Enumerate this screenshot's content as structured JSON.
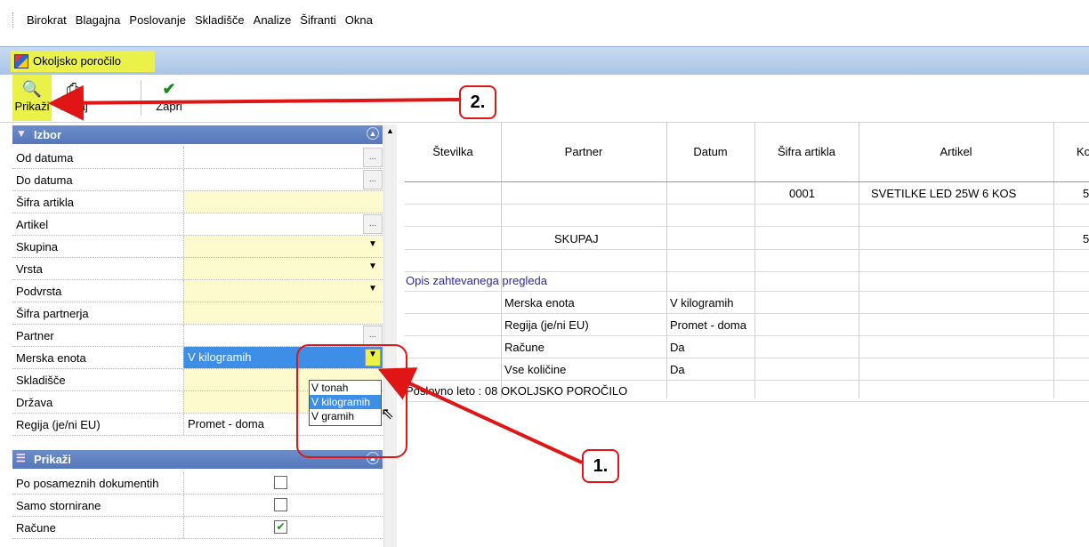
{
  "menu": [
    "Birokrat",
    "Blagajna",
    "Poslovanje",
    "Skladišče",
    "Analize",
    "Šifranti",
    "Okna"
  ],
  "window": {
    "title": "Okoljsko poročilo"
  },
  "toolbar": {
    "prikazi": "Prikaži",
    "tiskaj": "Tiskaj",
    "zapri": "Zapri"
  },
  "izbor": {
    "title": "Izbor",
    "rows": [
      {
        "label": "Od datuma",
        "value": ""
      },
      {
        "label": "Do datuma",
        "value": ""
      },
      {
        "label": "Šifra artikla",
        "value": ""
      },
      {
        "label": "Artikel",
        "value": ""
      },
      {
        "label": "Skupina",
        "value": ""
      },
      {
        "label": "Vrsta",
        "value": ""
      },
      {
        "label": "Podvrsta",
        "value": ""
      },
      {
        "label": "Šifra partnerja",
        "value": ""
      },
      {
        "label": "Partner",
        "value": ""
      },
      {
        "label": "Merska enota",
        "value": "V kilogramih"
      },
      {
        "label": "Skladišče",
        "value": ""
      },
      {
        "label": "Država",
        "value": ""
      },
      {
        "label": "Regija (je/ni EU)",
        "value": "Promet - doma"
      }
    ]
  },
  "dropdown": {
    "options": [
      "V tonah",
      "V kilogramih",
      "V gramih"
    ],
    "selected": "V kilogramih"
  },
  "prikazi": {
    "title": "Prikaži",
    "rows": [
      {
        "label": "Po posameznih dokumentih",
        "checked": false
      },
      {
        "label": "Samo stornirane",
        "checked": false
      },
      {
        "label": "Račune",
        "checked": true
      }
    ]
  },
  "grid": {
    "headers": [
      "Številka",
      "Partner",
      "Datum",
      "Šifra artikla",
      "Artikel",
      "Koli"
    ],
    "row1": {
      "sifra": "0001",
      "artikel": "SVETILKE LED 25W 6 KOS",
      "koli": "5"
    },
    "skupaj": {
      "label": "SKUPAJ",
      "koli": "5"
    },
    "opis": {
      "title": "Opis zahtevanega pregleda",
      "rows": [
        {
          "label": "Merska enota",
          "value": "V kilogramih"
        },
        {
          "label": "Regija (je/ni EU)",
          "value": "Promet - doma"
        },
        {
          "label": "Račune",
          "value": "Da"
        },
        {
          "label": "Vse količine",
          "value": "Da"
        }
      ]
    },
    "footer": "Poslovno leto : 08  OKOLJSKO POROČILO"
  },
  "annotations": {
    "step1": "1.",
    "step2": "2."
  },
  "colors": {
    "highlight": "#eaf24a",
    "annotation": "#e01515",
    "header": "#5578bb",
    "selection": "#3d8ee6"
  }
}
